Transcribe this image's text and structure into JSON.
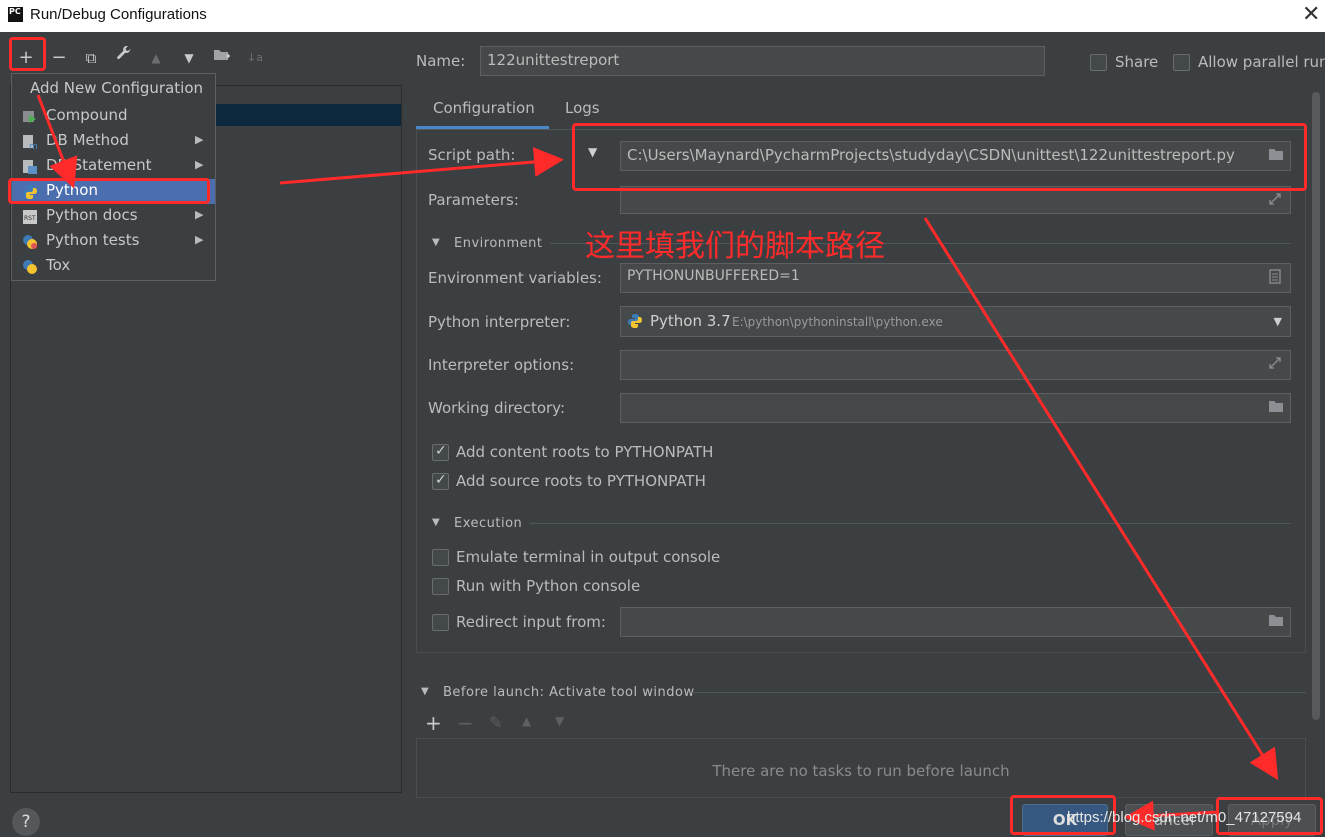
{
  "window": {
    "title": "Run/Debug Configurations",
    "close_glyph": "✕",
    "app_icon_text": "PC"
  },
  "toolbar": {
    "add": "+",
    "remove": "−",
    "copy": "⧉",
    "edit": "🔧",
    "up": "▲",
    "down": "▼",
    "folder": "📁",
    "sort": "↓a"
  },
  "add_menu": {
    "header": "Add New Configuration",
    "items": [
      {
        "label": "Compound",
        "submenu": false,
        "icon": "compound-icon"
      },
      {
        "label": "DB Method",
        "submenu": true,
        "icon": "db-method-icon"
      },
      {
        "label": "DB Statement",
        "submenu": true,
        "icon": "db-statement-icon"
      },
      {
        "label": "Python",
        "submenu": false,
        "icon": "python-icon",
        "selected": true
      },
      {
        "label": "Python docs",
        "submenu": true,
        "icon": "python-docs-icon"
      },
      {
        "label": "Python tests",
        "submenu": true,
        "icon": "python-tests-icon"
      },
      {
        "label": "Tox",
        "submenu": false,
        "icon": "tox-icon"
      }
    ],
    "submenu_arrow": "▶"
  },
  "config": {
    "name_label": "Name:",
    "name_value": "122unittestreport",
    "share_label": "Share",
    "share_checked": false,
    "parallel_label": "Allow parallel run",
    "parallel_checked": false,
    "tabs": [
      "Configuration",
      "Logs"
    ],
    "active_tab": "Configuration",
    "script_path_label": "Script path:",
    "script_path_value": "C:\\Users\\Maynard\\PycharmProjects\\studyday\\CSDN\\unittest\\122unittestreport.py",
    "script_dropdown_glyph": "▼",
    "parameters_label": "Parameters:",
    "parameters_value": "",
    "environment_section": "Environment",
    "env_vars_label": "Environment variables:",
    "env_vars_value": "PYTHONUNBUFFERED=1",
    "interpreter_label": "Python interpreter:",
    "interpreter_name": "Python 3.7",
    "interpreter_path": "E:\\python\\pythoninstall\\python.exe",
    "interp_options_label": "Interpreter options:",
    "interp_options_value": "",
    "working_dir_label": "Working directory:",
    "working_dir_value": "",
    "content_roots_label": "Add content roots to PYTHONPATH",
    "content_roots_checked": true,
    "source_roots_label": "Add source roots to PYTHONPATH",
    "source_roots_checked": true,
    "execution_section": "Execution",
    "emulate_label": "Emulate terminal in output console",
    "emulate_checked": false,
    "python_console_label": "Run with Python console",
    "python_console_checked": false,
    "redirect_label": "Redirect input from:",
    "redirect_checked": false,
    "redirect_value": "",
    "before_launch_label": "Before launch: Activate tool window",
    "before_launch_empty": "There are no tasks to run before launch",
    "before_launch_toolbar": {
      "add": "+",
      "remove": "−",
      "edit": "✎",
      "up": "▲",
      "down": "▼"
    }
  },
  "buttons": {
    "help": "?",
    "ok": "OK",
    "cancel": "Cancel",
    "apply": "Apply"
  },
  "annotation": {
    "note": "这里填我们的脚本路径",
    "color": "#ff2a2a"
  },
  "watermark": "https://blog.csdn.net/m0_47127594",
  "colors": {
    "bg": "#3c3f41",
    "field": "#45494a",
    "selected": "#4b6eaf",
    "tree_selected": "#0d293e",
    "accent": "#4a88c7"
  }
}
